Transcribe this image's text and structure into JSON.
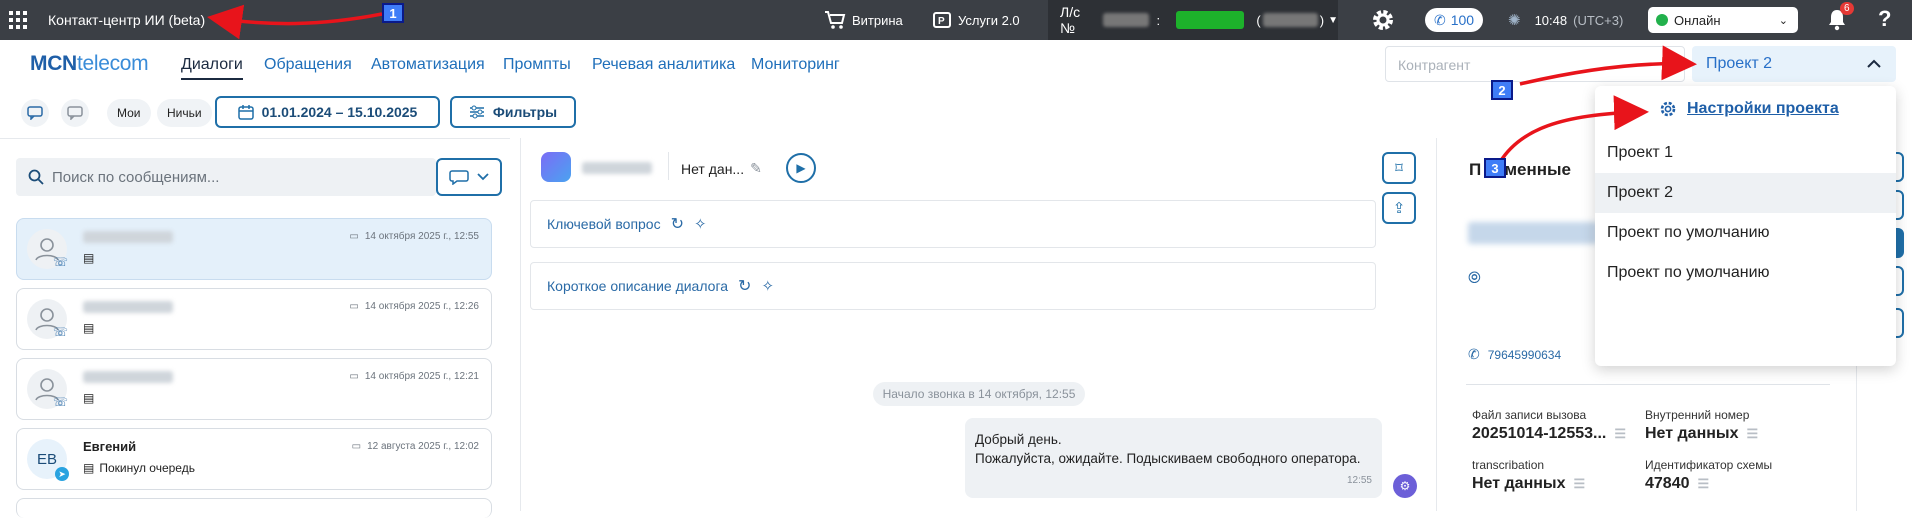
{
  "topbar": {
    "app_title": "Контакт-центр ИИ (beta)",
    "showcase": "Витрина",
    "services": "Услуги 2.0",
    "account_prefix": "Л/с №",
    "account_sep": ":",
    "account_paren": "(",
    "account_paren_close": ")",
    "calls_count": "100",
    "time": "10:48",
    "tz": "(UTC+3)",
    "status": "Онлайн",
    "notifications": "6",
    "help": "?"
  },
  "header": {
    "brand_a": "MCN",
    "brand_b": "telecom",
    "nav": [
      "Диалоги",
      "Обращения",
      "Автоматизация",
      "Промпты",
      "Речевая аналитика",
      "Мониторинг"
    ],
    "counterparty_placeholder": "Контрагент",
    "project_selected": "Проект 2"
  },
  "toolbar": {
    "mine": "Мои",
    "nobody": "Ничьи",
    "date_range": "01.01.2024 – 15.10.2025",
    "filters": "Фильтры"
  },
  "left": {
    "search_placeholder": "Поиск по сообщениям...",
    "cards": [
      {
        "name": "",
        "sub": "",
        "date": "14 октября 2025 г., 12:55",
        "selected": true
      },
      {
        "name": "",
        "sub": "",
        "date": "14 октября 2025 г., 12:26",
        "selected": false
      },
      {
        "name": "",
        "sub": "",
        "date": "14 октября 2025 г., 12:21",
        "selected": false
      },
      {
        "name": "Евгений",
        "sub": "Покинул очередь",
        "date": "12 августа 2025 г., 12:02",
        "initials": "ЕВ",
        "selected": false
      }
    ]
  },
  "center": {
    "no_data_short": "Нет дан...",
    "key_question": "Ключевой вопрос",
    "short_desc": "Короткое описание диалога",
    "call_start": "Начало звонка в 14 октября, 12:55",
    "bubble_line1": "Добрый день.",
    "bubble_line2": "Пожалуйста, ожидайте. Подыскиваем свободного оператора.",
    "bubble_time": "12:55"
  },
  "right": {
    "title_visible": "П",
    "title_tail": "еменные",
    "phone": "79645990634",
    "file_label": "Файл записи вызова",
    "file_value": "20251014-12553...",
    "internal_label": "Внутренний номер",
    "internal_value": "Нет данных",
    "transcr_label": "transcribation",
    "transcr_value": "Нет данных",
    "scheme_label": "Идентификатор схемы",
    "scheme_value": "47840"
  },
  "dropdown": {
    "settings": "Настройки проекта",
    "items": [
      "Проект 1",
      "Проект 2",
      "Проект по умолчанию",
      "Проект по умолчанию"
    ],
    "active_index": 1
  },
  "annotations": [
    "1",
    "2",
    "3"
  ],
  "colors": {
    "topbar": "#3b3f45",
    "brand": "#1f5fa8",
    "accent": "#1f6fa8",
    "online": "#22b14c",
    "arrow": "#e8141b"
  }
}
